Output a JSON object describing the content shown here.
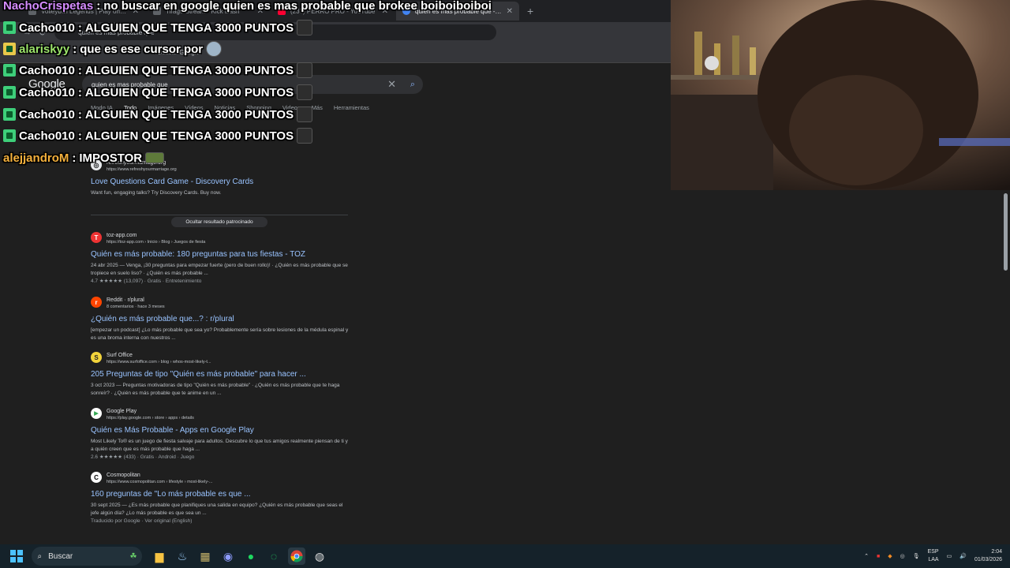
{
  "browser": {
    "tabs": [
      {
        "title": "Volleyball Legends | Play on Ro"
      },
      {
        "title": "Tirage Stream - Kick Dash"
      },
      {
        "title": "(237) PERRO PRO - YouTube"
      },
      {
        "title": "quien es mas probable que - Bu"
      }
    ],
    "address": "quien es mas probable que",
    "bookmark_label": "Buscar Google"
  },
  "google": {
    "logo": "Google",
    "query": "quien es mas probable que",
    "tabs": [
      "Modo IA",
      "Todo",
      "Imágenes",
      "Vídeos",
      "Noticias",
      "Shopping",
      "Videos",
      "Más",
      "Herramientas"
    ],
    "sponsored": {
      "site_name": "refreshyourmarriage.org",
      "url": "https://www.refreshyourmarriage.org",
      "title": "Love Questions Card Game - Discovery Cards",
      "snippet": "Want fun, engaging talks? Try Discovery Cards. Buy now.",
      "hide_label": "Ocultar resultado patrocinado"
    },
    "results": [
      {
        "icon": "toz-icon",
        "glyph": "T",
        "site": "toz-app.com",
        "url": "https://toz-app.com › Inicio › Blog › Juegos de fiesta",
        "title": "Quién es más probable: 180 preguntas para tus fiestas - TOZ",
        "snippet": "24 abr 2025 — Venga, ¡30 preguntas para empezar fuerte (pero de buen rollo)! · ¿Quién es más probable que se tropiece en suelo liso? · ¿Quién es más probable ...",
        "rating": "4.7 ★★★★★ (13,097) · Gratis · Entretenimiento"
      },
      {
        "icon": "reddit-icon",
        "glyph": "r",
        "site": "Reddit · r/plural",
        "url": "8 comentarios · hace 3 meses",
        "title": "¿Quién es más probable que...? : r/plural",
        "snippet": "[empezar un podcast] ¿Lo más probable que sea yo? Probablemente sería sobre lesiones de la médula espinal y es una broma interna con nuestros ...",
        "rating": ""
      },
      {
        "icon": "surfoffice-icon",
        "glyph": "S",
        "site": "Surf Office",
        "url": "https://www.surfoffice.com › blog › whos-most-likely-t...",
        "title": "205 Preguntas de tipo \"Quién es más probable\" para hacer ...",
        "snippet": "3 oct 2023 — Preguntas motivadoras de tipo \"Quién es más probable\" · ¿Quién es más probable que te haga sonreír? · ¿Quién es más probable que te anime en un ...",
        "rating": ""
      },
      {
        "icon": "googleplay-icon",
        "glyph": "▶",
        "site": "Google Play",
        "url": "https://play.google.com › store › apps › details",
        "title": "Quién es Más Probable - Apps en Google Play",
        "snippet": "Most Likely To® es un juego de fiesta salvaje para adultos. Descubre lo que tus amigos realmente piensan de ti y a quién creen que es más probable que haga ...",
        "rating": "2.6 ★★★★★ (433) · Gratis · Android · Juego"
      },
      {
        "icon": "cosmopolitan-icon",
        "glyph": "C",
        "site": "Cosmopolitan",
        "url": "https://www.cosmopolitan.com › lifestyle › most-likely-...",
        "title": "160 preguntas de \"Lo más probable es que ...",
        "snippet": "30 sept 2025 — ¿Es más probable que planifiques una salida en equipo? ¿Quién es más probable que seas el jefe algún día? ¿Lo más probable es que sea un ...",
        "rating": "Traducido por Google · Ver original (English)"
      }
    ]
  },
  "chat": {
    "messages": [
      {
        "user": "NachoCrispetas",
        "color": "#d58cff",
        "text": "no buscar en google quien es mas probable que brokee boiboiboiboi",
        "badge": false,
        "emote": false
      },
      {
        "user": "Cacho010",
        "color": "#ffffff",
        "text": "ALGUIEN QUE TENGA 3000 PUNTOS",
        "badge": true,
        "emote": true
      },
      {
        "user": "alariskyy",
        "color": "#ffffff",
        "text": "que es ese cursor por",
        "badge": true,
        "emote": true
      },
      {
        "user": "Cacho010",
        "color": "#ffffff",
        "text": "ALGUIEN QUE TENGA 3000 PUNTOS",
        "badge": true,
        "emote": true
      },
      {
        "user": "Cacho010",
        "color": "#ffffff",
        "text": "ALGUIEN QUE TENGA 3000 PUNTOS",
        "badge": true,
        "emote": true
      },
      {
        "user": "Cacho010",
        "color": "#ffffff",
        "text": "ALGUIEN QUE TENGA 3000 PUNTOS",
        "badge": true,
        "emote": true
      },
      {
        "user": "Cacho010",
        "color": "#ffffff",
        "text": "ALGUIEN QUE TENGA 3000 PUNTOS",
        "badge": true,
        "emote": true
      },
      {
        "user": "alejjandroM",
        "color": "#f4b03c",
        "text": "IMPOSTOR",
        "badge": false,
        "emote": true
      }
    ]
  },
  "taskbar": {
    "search_label": "Buscar",
    "lang_top": "ESP",
    "lang_bottom": "LAA",
    "time": "2:04",
    "date": "01/03/2026"
  }
}
